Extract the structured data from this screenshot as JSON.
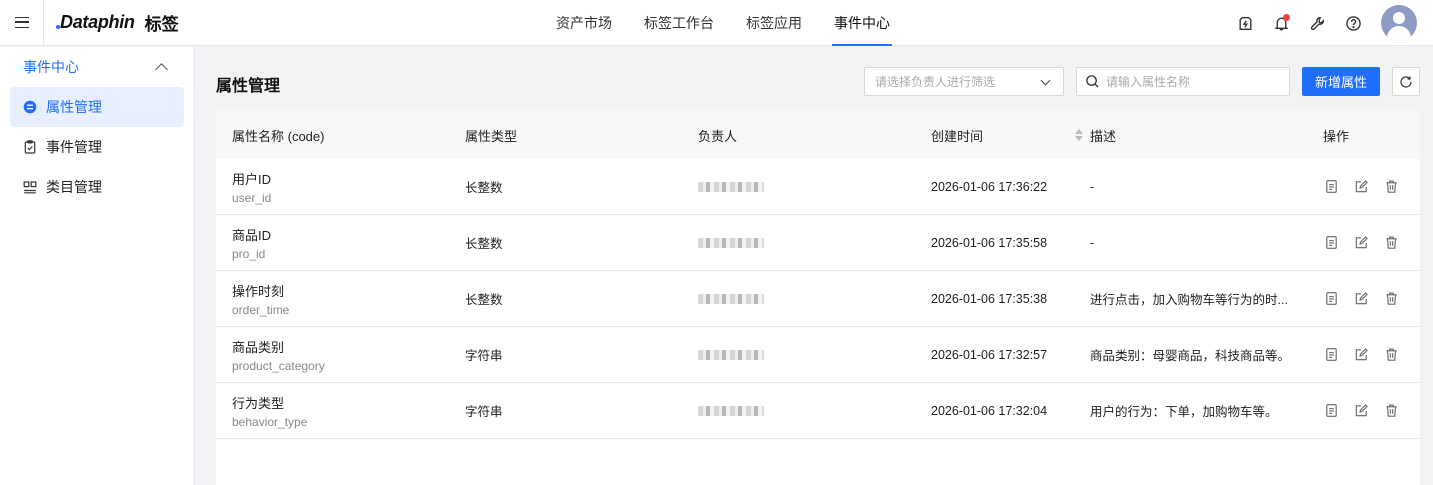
{
  "app": {
    "brand": "Dataphin",
    "module": "标签"
  },
  "topnav": [
    {
      "label": "资产市场",
      "active": false
    },
    {
      "label": "标签工作台",
      "active": false
    },
    {
      "label": "标签应用",
      "active": false
    },
    {
      "label": "事件中心",
      "active": true
    }
  ],
  "sidebar": {
    "group": "事件中心",
    "items": [
      {
        "label": "属性管理",
        "icon": "attribute-icon",
        "active": true
      },
      {
        "label": "事件管理",
        "icon": "clipboard-icon",
        "active": false
      },
      {
        "label": "类目管理",
        "icon": "category-icon",
        "active": false
      }
    ]
  },
  "page": {
    "title": "属性管理"
  },
  "toolbar": {
    "owner_filter_placeholder": "请选择负责人进行筛选",
    "search_placeholder": "请输入属性名称",
    "add_button": "新增属性"
  },
  "table": {
    "headers": {
      "name": "属性名称 (code)",
      "type": "属性类型",
      "owner": "负责人",
      "created": "创建时间",
      "desc": "描述",
      "ops": "操作"
    },
    "rows": [
      {
        "name": "用户ID",
        "code": "user_id",
        "type": "长整数",
        "created": "2026-01-06 17:36:22",
        "desc": "-"
      },
      {
        "name": "商品ID",
        "code": "pro_id",
        "type": "长整数",
        "created": "2026-01-06 17:35:58",
        "desc": "-"
      },
      {
        "name": "操作时刻",
        "code": "order_time",
        "type": "长整数",
        "created": "2026-01-06 17:35:38",
        "desc": "进行点击，加入购物车等行为的时..."
      },
      {
        "name": "商品类别",
        "code": "product_category",
        "type": "字符串",
        "created": "2026-01-06 17:32:57",
        "desc": "商品类别：母婴商品，科技商品等。"
      },
      {
        "name": "行为类型",
        "code": "behavior_type",
        "type": "字符串",
        "created": "2026-01-06 17:32:04",
        "desc": "用户的行为：下单，加购物车等。"
      }
    ]
  },
  "colors": {
    "accent": "#1f6fff",
    "alert": "#f53f3f"
  }
}
